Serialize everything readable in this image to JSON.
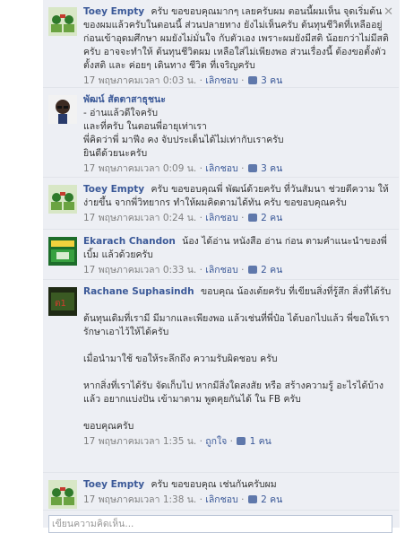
{
  "comments": [
    {
      "author": "Toey Empty",
      "text": "ครับ ขอขอบคุณมากๆ เลยครับผม ตอนนี้ผมเห็น จุดเริ่มต้น ของผมแล้วครับในตอนนี้ ส่วนปลายทาง ยังไม่เห็นครับ ต้นทุนชีวิตที่เหลืออยู่ ก่อนเข้าอุดมศึกษา ผมยังไม่มั่นใจ กับตัวเอง เพราะผมยังมีสติ น้อยกว่าไม่มีสติครับ อาจจะทำให้ ต้นทุนชีวิตผม เหลือใส่ไม่เพียงพอ ส่วนเรื่องนี้ ต้องขอตั้งตัว ตั้งสติ และ ค่อยๆ เดินทาง ชีวิต ที่เจริญครับ",
      "time": "17 พฤษภาคมเวลา 0:03 น.",
      "action": "เลิกชอบ",
      "likes": "3 คน"
    },
    {
      "author": "พัฒน์ สัตตาสาธุชนะ",
      "text": "- อ่านแล้วดีใจครับ\nและที่ครับ ในตอนพี่อายุเท่าเรา\nพี่คิดว่าพี่ มาฟีง คง จับประเด็นได้ไม่เท่ากับเราครับ\nยินดีด้วยนะครับ",
      "time": "17 พฤษภาคมเวลา 0:09 น.",
      "action": "เลิกชอบ",
      "likes": "3 คน"
    },
    {
      "author": "Toey Empty",
      "text": "ครับ ขอขอบคุณพี่ พัฒน์ด้วยครับ ที่วันสัมนา ช่วยตีความ ให้ง่ายขึ้น จากพี่วิทยากร ทำให้ผมคิดตามได้ทัน ครับ ขอขอบคุณครับ",
      "time": "17 พฤษภาคมเวลา 0:24 น.",
      "action": "เลิกชอบ",
      "likes": "2 คน"
    },
    {
      "author": "Ekarach Chandon",
      "text": "น้อง ได้อ่าน หนังสือ อ่าน ก่อน ตามคำแนะนำของพี่ เบิ้ม แล้วด้วยครับ",
      "time": "17 พฤษภาคมเวลา 0:33 น.",
      "action": "เลิกชอบ",
      "likes": "2 คน"
    },
    {
      "author": "Rachane Suphasindh",
      "text": "ขอบคุณ น้องเต้ยครับ ที่เขียนสิ่งที่รู้สึก สิ่งที่ได้รับ\n\nต้นทุนเดิมที่เรามี มีมากและเพียงพอ แล้วเช่นที่พี่ป๋อ ได้บอกไปแล้ว พี่ขอให้เรา รักษาเอาไว้ให้ได้ครับ\n\nเมื่อนำมาใช้ ขอให้ระลึกถึง ความรับผิดชอบ ครับ\n\nหากสิ่งที่เราได้รับ จัดเก็บไป หากมีสิ่งใดสงสัย หรือ สร้างความรู้ อะไรได้บ้างแล้ว อยากแบ่งปัน เข้ามาตาม พูดคุยกันได้ ใน FB ครับ\n\nขอบคุณครับ",
      "time": "17 พฤษภาคมเวลา 1:35 น.",
      "action": "ถูกใจ",
      "likes": "1 คน"
    },
    {
      "author": "Toey Empty",
      "text": "ครับ ขอขอบคุณ เช่นกันครับผม",
      "time": "17 พฤษภาคมเวลา 1:38 น.",
      "action": "เลิกชอบ",
      "likes": "2 คน"
    }
  ],
  "input_placeholder": "เขียนความคิดเห็น..."
}
